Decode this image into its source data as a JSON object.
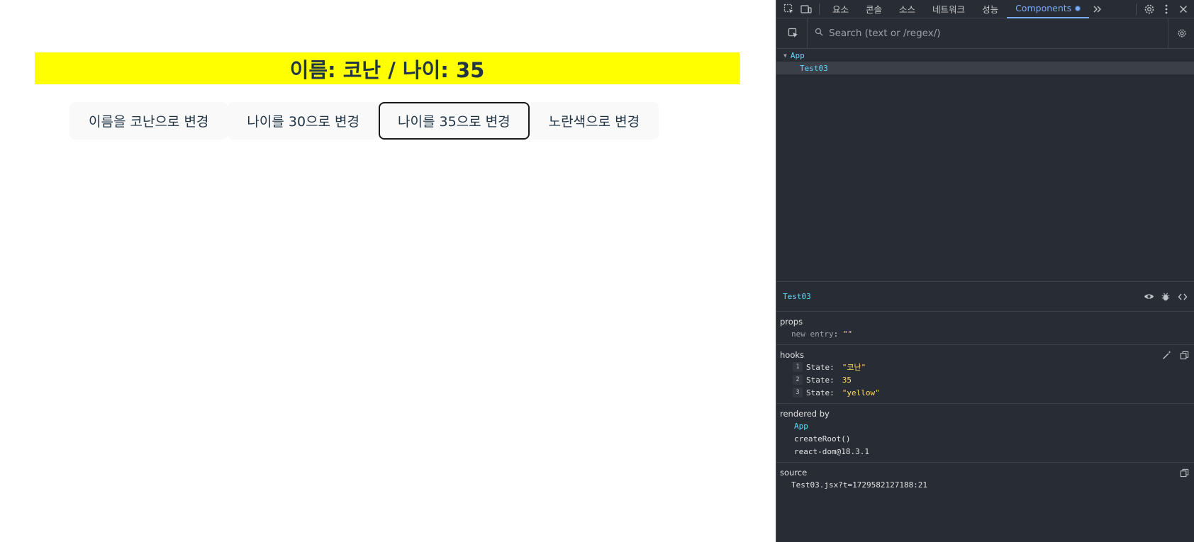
{
  "app": {
    "banner_text": "이름: 코난 / 나이: 35",
    "banner_bg": "#ffff00",
    "buttons": [
      {
        "label": "이름을 코난으로 변경"
      },
      {
        "label": "나이를 30으로 변경"
      },
      {
        "label": "나이를 35으로 변경"
      },
      {
        "label": "노란색으로 변경"
      }
    ]
  },
  "devtools": {
    "tabs": [
      "요소",
      "콘솔",
      "소스",
      "네트워크",
      "성능",
      "Components"
    ],
    "active_tab": "Components",
    "search_placeholder": "Search (text or /regex/)",
    "tree": [
      {
        "name": "App",
        "level": 0
      },
      {
        "name": "Test03",
        "level": 1,
        "selected": true
      }
    ],
    "inspector": {
      "component": "Test03",
      "props_title": "props",
      "props": [
        {
          "key": "new entry",
          "value": "\"\""
        }
      ],
      "hooks_title": "hooks",
      "hooks": [
        {
          "index": "1",
          "label": "State:",
          "value": "\"코난\""
        },
        {
          "index": "2",
          "label": "State:",
          "value": "35"
        },
        {
          "index": "3",
          "label": "State:",
          "value": "\"yellow\""
        }
      ],
      "rendered_by_title": "rendered by",
      "rendered_by": [
        {
          "name": "App",
          "is_component": true
        },
        {
          "name": "createRoot()",
          "is_component": false
        },
        {
          "name": "react-dom@18.3.1",
          "is_component": false
        }
      ],
      "source_title": "source",
      "source": "Test03.jsx?t=1729582127188:21"
    },
    "colors": {
      "background": "#282c34",
      "accent": "#7cacf8",
      "component": "#61dafb",
      "value": "#ffd866"
    }
  }
}
